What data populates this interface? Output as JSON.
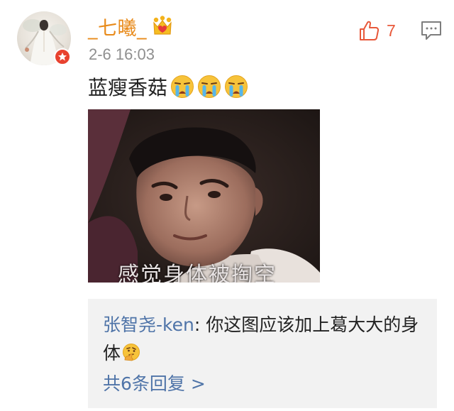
{
  "comment": {
    "username": "_七曦_",
    "timestamp": "2-6 16:03",
    "like_count": "7",
    "text": "蓝瘦香菇",
    "emoji_count": 3,
    "emoji": "crying-face",
    "image_caption": "感觉身体被掏空"
  },
  "reply_preview": {
    "author": "张智尧-ken",
    "separator": ": ",
    "text": "你这图应该加上葛大大的身体",
    "emoji": "thinking-face",
    "more_replies_label": "共6条回复 >"
  },
  "colors": {
    "username": "#e88a1a",
    "link": "#4f74a8",
    "like": "#e8583a",
    "badge": "#e8422f",
    "reply_bg": "#f2f2f2"
  }
}
